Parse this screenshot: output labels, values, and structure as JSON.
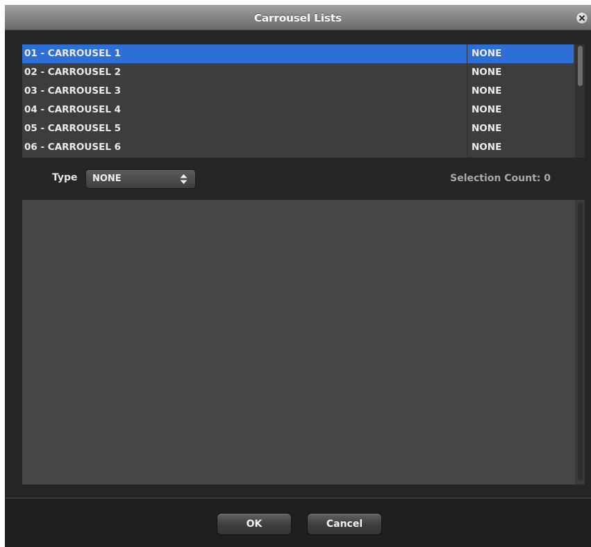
{
  "window": {
    "title": "Carrousel Lists"
  },
  "carousel_list": {
    "rows": [
      {
        "name": "01 - CARROUSEL 1",
        "value": "NONE",
        "selected": true
      },
      {
        "name": "02 - CARROUSEL 2",
        "value": "NONE",
        "selected": false
      },
      {
        "name": "03 - CARROUSEL 3",
        "value": "NONE",
        "selected": false
      },
      {
        "name": "04 - CARROUSEL 4",
        "value": "NONE",
        "selected": false
      },
      {
        "name": "05 - CARROUSEL 5",
        "value": "NONE",
        "selected": false
      },
      {
        "name": "06 - CARROUSEL 6",
        "value": "NONE",
        "selected": false
      }
    ]
  },
  "type_selector": {
    "label": "Type",
    "value": "NONE"
  },
  "selection_count": "Selection Count: 0",
  "buttons": {
    "ok": "OK",
    "cancel": "Cancel"
  },
  "colors": {
    "selection": "#2d6fd6",
    "window_bg": "#262626",
    "list_bg": "#3d3d3d",
    "panel_bg": "#474747"
  },
  "icons": {
    "close": "close-icon",
    "select": "up-down-arrows-icon"
  }
}
